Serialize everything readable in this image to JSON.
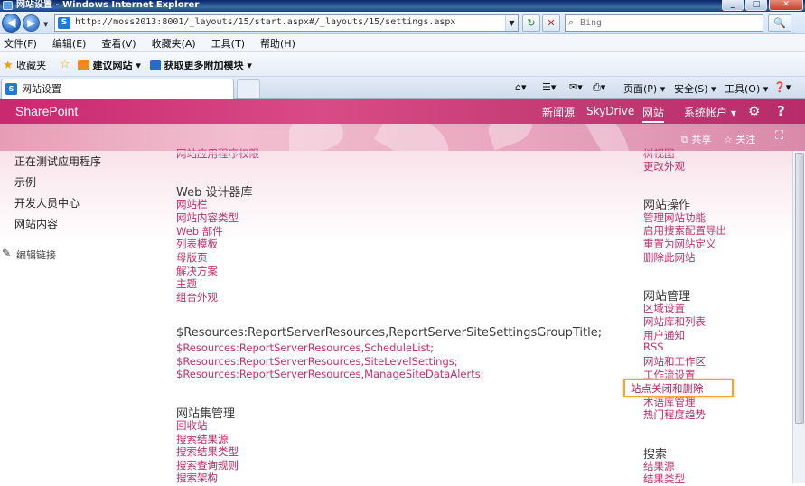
{
  "window": {
    "title": "网站设置 - Windows Internet Explorer",
    "min": "_",
    "max": "□",
    "close": "✕"
  },
  "addressbar": {
    "back": "◀",
    "forward": "▶",
    "url": "http://moss2013:8001/_layouts/15/start.aspx#/_layouts/15/settings.aspx",
    "refresh": "↻",
    "stop": "✕",
    "search_placeholder": "Bing",
    "search_go": "🔍"
  },
  "menu": [
    "文件(F)",
    "编辑(E)",
    "查看(V)",
    "收藏夹(A)",
    "工具(T)",
    "帮助(H)"
  ],
  "favorites": {
    "label": "收藏夹",
    "items": [
      "建议网站 ▾",
      "获取更多附加模块 ▾"
    ]
  },
  "tabs": {
    "active": "网站设置"
  },
  "commandbar": {
    "page": "页面(P) ▾",
    "safety": "安全(S) ▾",
    "tools": "工具(O) ▾",
    "help": "❓▾"
  },
  "suitebar": {
    "brand": "SharePoint",
    "links": [
      "新闻源",
      "SkyDrive",
      "网站"
    ],
    "account": "系统帐户 ▾",
    "gear": "⚙",
    "help": "?"
  },
  "banner": {
    "share": "共享",
    "follow": "关注",
    "focus": "⛶"
  },
  "leftnav": {
    "items": [
      "正在测试应用程序",
      "示例",
      "开发人员中心",
      "网站内容"
    ],
    "edit_links": "编辑链接"
  },
  "middle": {
    "cut_top": "网站应用程序权限",
    "web_designer": {
      "heading": "Web 设计器库",
      "links": [
        "网站栏",
        "网站内容类型",
        "Web 部件",
        "列表模板",
        "母版页",
        "解决方案",
        "主题",
        "组合外观"
      ]
    },
    "report_server": {
      "heading": "$Resources:ReportServerResources,ReportServerSiteSettingsGroupTitle;",
      "links": [
        "$Resources:ReportServerResources,ScheduleList;",
        "$Resources:ReportServerResources,SiteLevelSettings;",
        "$Resources:ReportServerResources,ManageSiteDataAlerts;"
      ]
    },
    "site_collection": {
      "heading": "网站集管理",
      "links": [
        "回收站",
        "搜索结果源",
        "搜索结果类型",
        "搜索查询规则",
        "搜索架构"
      ]
    }
  },
  "right": {
    "cut_top": [
      "树视图",
      "更改外观"
    ],
    "site_actions": {
      "heading": "网站操作",
      "links": [
        "管理网站功能",
        "启用搜索配置导出",
        "重置为网站定义",
        "删除此网站"
      ]
    },
    "site_admin": {
      "heading": "网站管理",
      "links": [
        "区域设置",
        "网站库和列表",
        "用户通知",
        "RSS",
        "网站和工作区",
        "工作流设置",
        "站点关闭和删除",
        "术语库管理",
        "热门程度趋势"
      ]
    },
    "search": {
      "heading": "搜索",
      "links": [
        "结果源",
        "结果类型"
      ]
    }
  },
  "colors": {
    "link": "#c0306c",
    "suitebar": "#c9286f",
    "highlight": "#f3a339"
  }
}
